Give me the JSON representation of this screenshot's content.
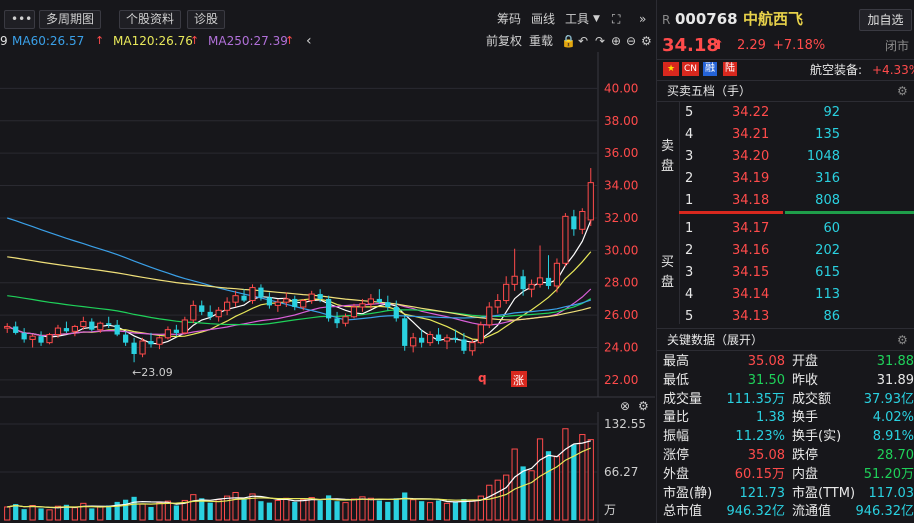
{
  "toolbar": {
    "more_label": "•••",
    "multi_period_label": "多周期图",
    "stock_info_label": "个股资料",
    "diagnose_label": "诊股",
    "chips_label": "筹码",
    "draw_label": "画线",
    "tools_label": "工具",
    "adj_label": "前复权",
    "overlay_label": "重载"
  },
  "ma_legend": {
    "cut_value": "9",
    "ma60": "MA60:26.57",
    "ma120": "MA120:26.76",
    "ma250": "MA250:27.39",
    "colors": {
      "ma60": "#3aa0e8",
      "ma120": "#e8e85a",
      "ma250": "#b070d8"
    }
  },
  "chart_data": {
    "type": "candlestick",
    "ylim": [
      21.5,
      42
    ],
    "y_ticks": [
      "40.00",
      "38.00",
      "36.00",
      "34.00",
      "32.00",
      "30.00",
      "28.00",
      "26.00",
      "24.00",
      "22.00"
    ],
    "y_tick_values": [
      40,
      38,
      36,
      34,
      32,
      30,
      28,
      26,
      24,
      22
    ],
    "low_annotation": "←23.09",
    "markers": {
      "q": "q",
      "zhang": "涨"
    },
    "candles": [
      [
        25.2,
        25.5,
        24.9,
        25.3
      ],
      [
        25.3,
        25.6,
        24.8,
        24.9
      ],
      [
        24.9,
        25.2,
        24.3,
        24.5
      ],
      [
        24.5,
        24.8,
        24.0,
        24.7
      ],
      [
        24.7,
        25.0,
        24.1,
        24.3
      ],
      [
        24.3,
        24.9,
        24.2,
        24.8
      ],
      [
        24.8,
        25.4,
        24.6,
        25.2
      ],
      [
        25.2,
        25.6,
        24.9,
        25.0
      ],
      [
        25.0,
        25.4,
        24.7,
        25.3
      ],
      [
        25.3,
        25.9,
        25.1,
        25.6
      ],
      [
        25.6,
        25.8,
        25.0,
        25.1
      ],
      [
        25.1,
        25.6,
        24.9,
        25.5
      ],
      [
        25.5,
        25.9,
        25.2,
        25.4
      ],
      [
        25.4,
        25.7,
        24.7,
        24.8
      ],
      [
        24.8,
        25.0,
        24.1,
        24.3
      ],
      [
        24.3,
        24.6,
        23.09,
        23.6
      ],
      [
        23.6,
        24.6,
        23.4,
        24.4
      ],
      [
        24.4,
        24.9,
        24.0,
        24.2
      ],
      [
        24.2,
        24.7,
        23.9,
        24.6
      ],
      [
        24.6,
        25.3,
        24.5,
        25.1
      ],
      [
        25.1,
        25.4,
        24.7,
        24.9
      ],
      [
        24.9,
        25.9,
        24.8,
        25.7
      ],
      [
        25.7,
        26.9,
        25.5,
        26.6
      ],
      [
        26.6,
        26.9,
        26.0,
        26.2
      ],
      [
        26.2,
        26.6,
        25.7,
        25.9
      ],
      [
        25.9,
        26.5,
        25.6,
        26.3
      ],
      [
        26.3,
        27.1,
        26.0,
        26.8
      ],
      [
        26.8,
        27.5,
        26.5,
        27.2
      ],
      [
        27.2,
        27.6,
        26.8,
        26.9
      ],
      [
        26.9,
        27.9,
        26.7,
        27.7
      ],
      [
        27.7,
        27.9,
        26.9,
        27.1
      ],
      [
        27.1,
        27.4,
        26.4,
        26.6
      ],
      [
        26.6,
        27.0,
        26.2,
        26.8
      ],
      [
        26.8,
        27.4,
        26.5,
        27.0
      ],
      [
        27.0,
        27.2,
        26.3,
        26.5
      ],
      [
        26.5,
        27.0,
        26.3,
        26.9
      ],
      [
        26.9,
        27.5,
        26.7,
        27.3
      ],
      [
        27.3,
        27.6,
        26.8,
        27.0
      ],
      [
        27.0,
        27.2,
        25.6,
        25.8
      ],
      [
        25.8,
        26.2,
        25.2,
        25.5
      ],
      [
        25.5,
        26.1,
        25.3,
        25.9
      ],
      [
        25.9,
        26.7,
        25.8,
        26.5
      ],
      [
        26.5,
        27.0,
        26.2,
        26.7
      ],
      [
        26.7,
        27.3,
        26.4,
        27.0
      ],
      [
        27.0,
        27.6,
        26.7,
        26.8
      ],
      [
        26.8,
        27.2,
        26.3,
        26.5
      ],
      [
        26.5,
        26.9,
        25.6,
        25.8
      ],
      [
        25.8,
        26.0,
        23.8,
        24.1
      ],
      [
        24.1,
        24.9,
        23.7,
        24.6
      ],
      [
        24.6,
        25.1,
        24.0,
        24.3
      ],
      [
        24.3,
        25.0,
        24.1,
        24.8
      ],
      [
        24.8,
        25.2,
        24.2,
        24.4
      ],
      [
        24.4,
        24.8,
        23.9,
        24.6
      ],
      [
        24.6,
        25.1,
        24.3,
        24.5
      ],
      [
        24.5,
        24.9,
        23.6,
        23.8
      ],
      [
        23.8,
        24.5,
        23.5,
        24.3
      ],
      [
        24.3,
        25.6,
        24.2,
        25.4
      ],
      [
        25.4,
        26.8,
        25.2,
        26.5
      ],
      [
        26.5,
        27.3,
        26.1,
        26.9
      ],
      [
        26.9,
        28.4,
        26.7,
        27.9
      ],
      [
        27.9,
        30.1,
        27.5,
        28.4
      ],
      [
        28.4,
        28.8,
        27.2,
        27.6
      ],
      [
        27.6,
        28.2,
        27.1,
        27.9
      ],
      [
        27.9,
        30.3,
        27.7,
        28.3
      ],
      [
        28.3,
        29.7,
        27.6,
        27.8
      ],
      [
        27.8,
        29.5,
        27.4,
        29.2
      ],
      [
        29.2,
        32.3,
        29.0,
        32.1
      ],
      [
        32.1,
        32.5,
        30.9,
        31.3
      ],
      [
        31.3,
        32.6,
        31.0,
        32.4
      ],
      [
        31.88,
        35.08,
        31.5,
        34.18
      ]
    ],
    "vol_ticks": [
      "132.55",
      "66.27",
      "万"
    ],
    "vol_max": 132.55,
    "volumes": [
      18,
      22,
      15,
      20,
      16,
      14,
      19,
      21,
      17,
      23,
      16,
      18,
      20,
      25,
      28,
      32,
      22,
      18,
      24,
      26,
      20,
      27,
      35,
      30,
      24,
      28,
      33,
      38,
      29,
      36,
      26,
      24,
      27,
      30,
      25,
      28,
      31,
      27,
      34,
      26,
      24,
      29,
      32,
      30,
      27,
      25,
      30,
      38,
      28,
      26,
      24,
      27,
      23,
      25,
      29,
      26,
      33,
      48,
      55,
      62,
      98,
      74,
      68,
      112,
      95,
      88,
      126,
      104,
      118,
      111
    ]
  },
  "quote": {
    "market_prefix": "R",
    "code": "000768",
    "name": "中航西飞",
    "add_button": "加自选",
    "price": "34.18",
    "change": "2.29",
    "change_pct": "+7.18%",
    "status": "闭市",
    "tags": [
      "CN",
      "融",
      "陆"
    ],
    "sector": "航空装备:",
    "sector_change": "+4.33%",
    "orderbook_title": "买卖五档（手）",
    "sell_label": [
      "卖",
      "盘"
    ],
    "buy_label": [
      "买",
      "盘"
    ],
    "asks": [
      {
        "level": "5",
        "price": "34.22",
        "vol": "92"
      },
      {
        "level": "4",
        "price": "34.21",
        "vol": "135"
      },
      {
        "level": "3",
        "price": "34.20",
        "vol": "1048"
      },
      {
        "level": "2",
        "price": "34.19",
        "vol": "316"
      },
      {
        "level": "1",
        "price": "34.18",
        "vol": "808"
      }
    ],
    "bids": [
      {
        "level": "1",
        "price": "34.17",
        "vol": "60"
      },
      {
        "level": "2",
        "price": "34.16",
        "vol": "202"
      },
      {
        "level": "3",
        "price": "34.15",
        "vol": "615"
      },
      {
        "level": "4",
        "price": "34.14",
        "vol": "113"
      },
      {
        "level": "5",
        "price": "34.13",
        "vol": "86"
      }
    ],
    "key_title": "关键数据（展开）",
    "key_rows": [
      {
        "l1": "最高",
        "v1": "35.08",
        "c1": "red",
        "l2": "开盘",
        "v2": "31.88",
        "c2": "green"
      },
      {
        "l1": "最低",
        "v1": "31.50",
        "c1": "green",
        "l2": "昨收",
        "v2": "31.89",
        "c2": "white"
      },
      {
        "l1": "成交量",
        "v1": "111.35万",
        "c1": "cyan",
        "l2": "成交额",
        "v2": "37.93亿",
        "c2": "cyan"
      },
      {
        "l1": "量比",
        "v1": "1.38",
        "c1": "cyan",
        "l2": "换手",
        "v2": "4.02%",
        "c2": "cyan"
      },
      {
        "l1": "振幅",
        "v1": "11.23%",
        "c1": "cyan",
        "l2": "换手(实)",
        "v2": "8.91%",
        "c2": "cyan"
      },
      {
        "l1": "涨停",
        "v1": "35.08",
        "c1": "red",
        "l2": "跌停",
        "v2": "28.70",
        "c2": "green"
      },
      {
        "l1": "外盘",
        "v1": "60.15万",
        "c1": "red",
        "l2": "内盘",
        "v2": "51.20万",
        "c2": "green"
      },
      {
        "l1": "市盈(静)",
        "v1": "121.73",
        "c1": "cyan",
        "l2": "市盈(TTM)",
        "v2": "117.03",
        "c2": "cyan"
      },
      {
        "l1": "总市值",
        "v1": "946.32亿",
        "c1": "cyan",
        "l2": "流通值",
        "v2": "946.32亿",
        "c2": "cyan"
      }
    ]
  }
}
